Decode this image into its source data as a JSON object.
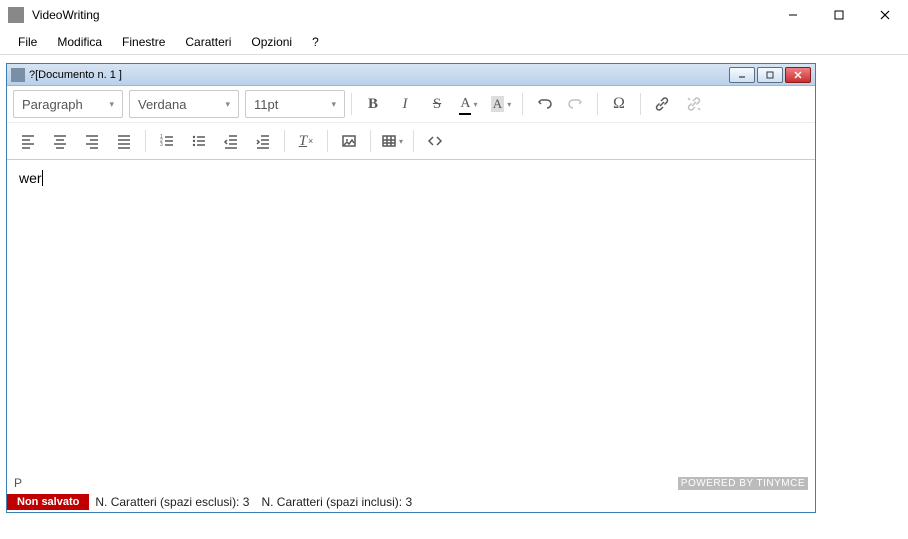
{
  "app": {
    "title": "VideoWriting"
  },
  "menu": {
    "file": "File",
    "modifica": "Modifica",
    "finestre": "Finestre",
    "caratteri": "Caratteri",
    "opzioni": "Opzioni",
    "help": "?"
  },
  "child": {
    "title": "?[Documento n. 1 ]"
  },
  "toolbar": {
    "block": "Paragraph",
    "font": "Verdana",
    "size": "11pt"
  },
  "editor": {
    "content": "wer",
    "path": "P",
    "powered": "POWERED BY TINYMCE"
  },
  "status": {
    "badge": "Non salvato",
    "chars_excl_label": "N. Caratteri (spazi esclusi):",
    "chars_excl_value": "3",
    "chars_incl_label": "N. Caratteri (spazi inclusi):",
    "chars_incl_value": "3"
  }
}
